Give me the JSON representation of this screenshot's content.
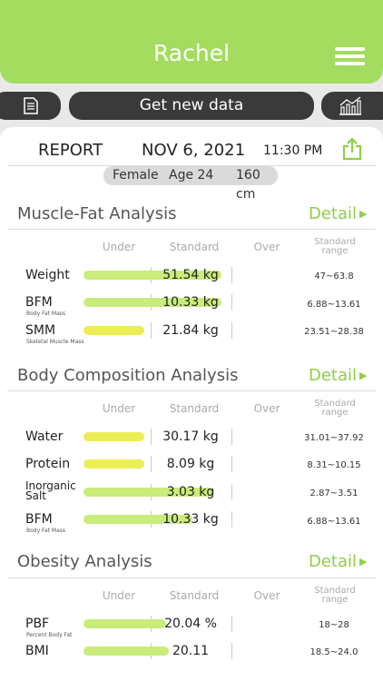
{
  "header": {
    "title": "Rachel",
    "menu_icon": "hamburger-menu-icon"
  },
  "toolbar": {
    "left_icon": "document-icon",
    "get_data_label": "Get new data",
    "right_icon": "trend-chart-icon"
  },
  "report": {
    "label": "REPORT",
    "date": "NOV 6, 2021",
    "time": "11:30 PM",
    "share_icon": "share-icon",
    "profile": {
      "gender": "Female",
      "age": "Age 24",
      "height": "160 cm"
    }
  },
  "columns": {
    "under": "Under",
    "standard": "Standard",
    "over": "Over",
    "range_line1": "Standard",
    "range_line2": "range"
  },
  "sections": [
    {
      "title": "Muscle-Fat Analysis",
      "detail": "Detail",
      "rows": [
        {
          "label": "Weight",
          "sub": "",
          "value": "51.54 kg",
          "range": "47~63.8",
          "fill": 0.95,
          "color": "green"
        },
        {
          "label": "BFM",
          "sub": "Body Fat Mass",
          "value": "10.33 kg",
          "range": "6.88~13.61",
          "fill": 0.95,
          "color": "green"
        },
        {
          "label": "SMM",
          "sub": "Skeletal Muscle Mass",
          "value": "21.84 kg",
          "range": "23.51~28.38",
          "fill": 0.42,
          "color": "yellow"
        }
      ]
    },
    {
      "title": "Body Composition Analysis",
      "detail": "Detail",
      "rows": [
        {
          "label": "Water",
          "sub": "",
          "value": "30.17 kg",
          "range": "31.01~37.92",
          "fill": 0.42,
          "color": "yellow"
        },
        {
          "label": "Protein",
          "sub": "",
          "value": "8.09 kg",
          "range": "8.31~10.15",
          "fill": 0.42,
          "color": "yellow"
        },
        {
          "label": "Inorganic Salt",
          "sub": "",
          "value": "3.03 kg",
          "range": "2.87~3.51",
          "fill": 0.9,
          "color": "green"
        },
        {
          "label": "BFM",
          "sub": "Body Fat Mass",
          "value": "10.33 kg",
          "range": "6.88~13.61",
          "fill": 0.75,
          "color": "green"
        }
      ]
    },
    {
      "title": "Obesity Analysis",
      "detail": "Detail",
      "rows": [
        {
          "label": "PBF",
          "sub": "Percent Body Fat",
          "value": "20.04 %",
          "range": "18~28",
          "fill": 0.57,
          "color": "green"
        },
        {
          "label": "BMI",
          "sub": "",
          "value": "20.11",
          "range": "18.5~24.0",
          "fill": 0.59,
          "color": "green"
        }
      ]
    }
  ]
}
